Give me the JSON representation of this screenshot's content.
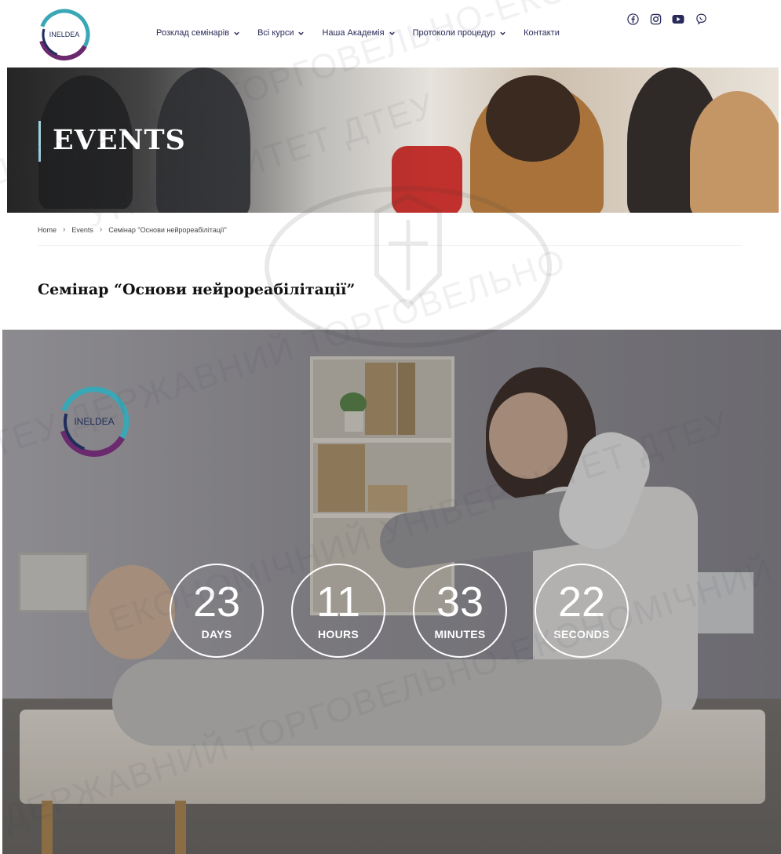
{
  "header": {
    "logo_text": "INELDEA",
    "nav": [
      {
        "label": "Розклад семінарів",
        "dropdown": true
      },
      {
        "label": "Всі курси",
        "dropdown": true
      },
      {
        "label": "Наша Академія",
        "dropdown": true
      },
      {
        "label": "Протоколи процедур",
        "dropdown": true
      },
      {
        "label": "Контакти",
        "dropdown": false
      }
    ],
    "socials": [
      "facebook-icon",
      "instagram-icon",
      "youtube-icon",
      "viber-icon"
    ]
  },
  "hero": {
    "title": "EVENTS"
  },
  "breadcrumb": {
    "items": [
      "Home",
      "Events",
      "Семінар \"Основи нейрореабілітації\""
    ]
  },
  "page": {
    "title": "Семінар “Основи нейрореабілітації”"
  },
  "event": {
    "logo_text": "INELDEA",
    "countdown": [
      {
        "value": "23",
        "label": "DAYS"
      },
      {
        "value": "11",
        "label": "HOURS"
      },
      {
        "value": "33",
        "label": "MINUTES"
      },
      {
        "value": "22",
        "label": "SECONDS"
      }
    ]
  },
  "watermark": {
    "text": "УНІВЕРСИТЕТ ДТЕУ ДЕРЖАВНИЙ ТОРГОВЕЛЬНО-ЕКОНОМІЧНИЙ",
    "lines": [
      "ДЕРЖАВНИЙ ТОРГОВЕЛЬНО-ЕКОНОМІЧНИЙ",
      "УНІВЕРСИТЕТ ДТЕУ",
      "ДТЕУ ДЕРЖАВНИЙ ТОРГОВЕЛЬНО",
      "ЕКОНОМІЧНИЙ УНІВЕРСИТЕТ ДТЕУ"
    ]
  },
  "colors": {
    "nav_text": "#2a2a5a",
    "logo_teal": "#3aa7b6",
    "logo_purple": "#6b2a6e",
    "logo_navy": "#1f2d5a",
    "countdown_ring": "#ffffff"
  }
}
